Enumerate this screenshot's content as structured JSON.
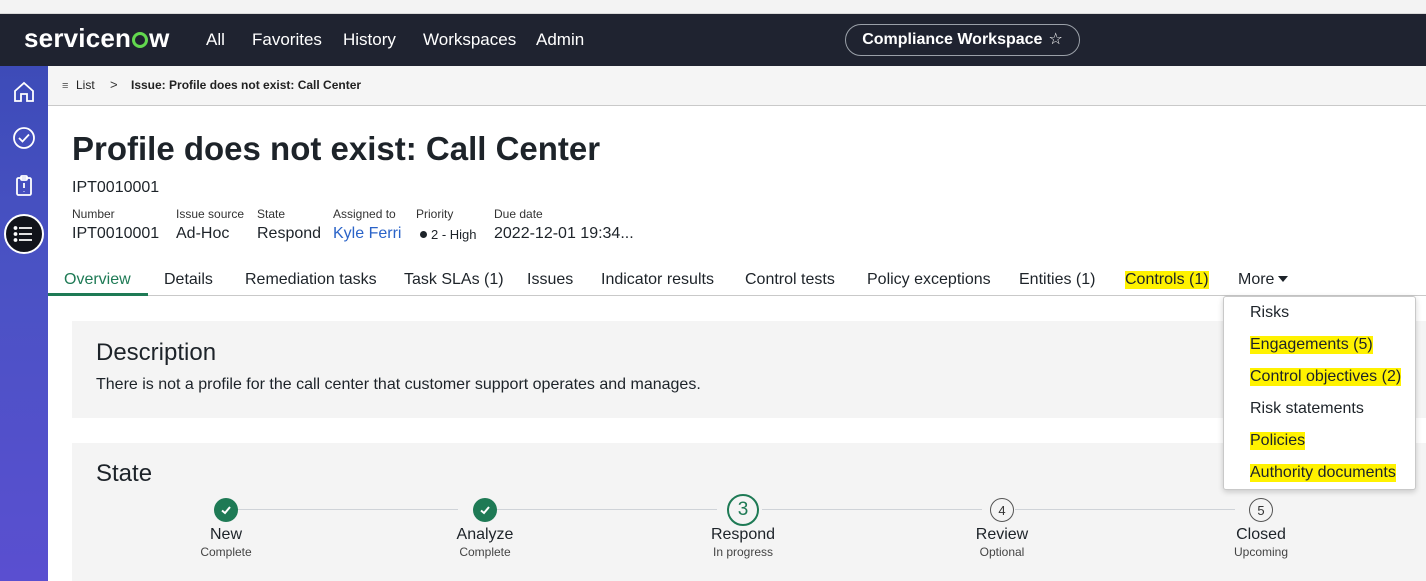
{
  "topnav": {
    "logo": "servicenow",
    "items": [
      "All",
      "Favorites",
      "History",
      "Workspaces",
      "Admin"
    ],
    "workspace": "Compliance Workspace"
  },
  "sidebar": {
    "icons": [
      "home-icon",
      "check-circle-icon",
      "clipboard-icon",
      "list-icon"
    ]
  },
  "breadcrumb": {
    "list_label": "List",
    "separator": ">",
    "current": "Issue: Profile does not exist: Call Center"
  },
  "record": {
    "title": "Profile does not exist: Call Center",
    "id": "IPT0010001",
    "fields": [
      {
        "label": "Number",
        "value": "IPT0010001"
      },
      {
        "label": "Issue source",
        "value": "Ad-Hoc"
      },
      {
        "label": "State",
        "value": "Respond"
      },
      {
        "label": "Assigned to",
        "value": "Kyle Ferri"
      },
      {
        "label": "Priority",
        "value": "2 - High"
      },
      {
        "label": "Due date",
        "value": "2022-12-01 19:34..."
      }
    ]
  },
  "tabs": [
    "Overview",
    "Details",
    "Remediation tasks",
    "Task SLAs (1)",
    "Issues",
    "Indicator results",
    "Control tests",
    "Policy exceptions",
    "Entities (1)",
    "Controls (1)",
    "More"
  ],
  "more_menu": [
    "Risks",
    "Engagements (5)",
    "Control objectives (2)",
    "Risk statements",
    "Policies",
    "Authority documents"
  ],
  "description": {
    "title": "Description",
    "text": "There is not a profile for the call center that customer support operates and manages."
  },
  "state": {
    "title": "State",
    "steps": [
      {
        "marker": "",
        "name": "New",
        "status": "Complete"
      },
      {
        "marker": "",
        "name": "Analyze",
        "status": "Complete"
      },
      {
        "marker": "3",
        "name": "Respond",
        "status": "In progress"
      },
      {
        "marker": "4",
        "name": "Review",
        "status": "Optional"
      },
      {
        "marker": "5",
        "name": "Closed",
        "status": "Upcoming"
      }
    ]
  },
  "colors": {
    "nav_bg": "#1f2330",
    "accent_green": "#1e7a55",
    "highlight": "#fff200",
    "link": "#2a63c8",
    "sidebar": "#4a52c4"
  }
}
